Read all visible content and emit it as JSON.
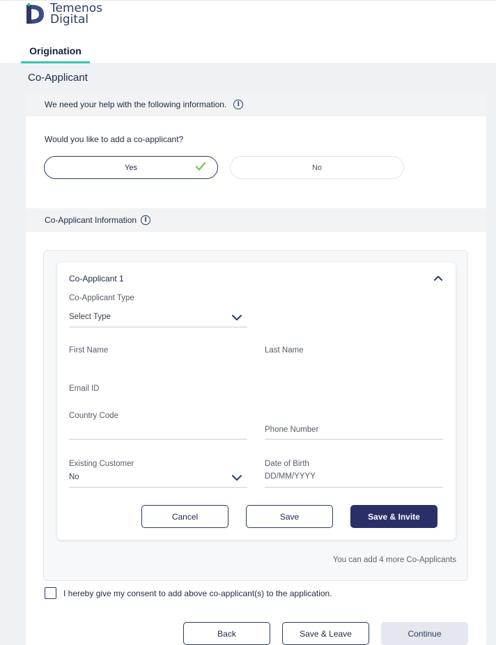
{
  "brand": {
    "line1": "Temenos",
    "line2": "Digital"
  },
  "nav": {
    "tab_label": "Origination"
  },
  "page": {
    "title": "Co-Applicant"
  },
  "help_banner": {
    "text": "We need your help with the following information."
  },
  "question": {
    "text": "Would you like to add a co-applicant?",
    "options": [
      {
        "label": "Yes",
        "selected": true
      },
      {
        "label": "No",
        "selected": false
      }
    ]
  },
  "section": {
    "title": "Co-Applicant Information"
  },
  "coapplicant": {
    "title": "Co-Applicant 1",
    "type": {
      "label": "Co-Applicant Type",
      "value": "Select Type"
    },
    "first_name": {
      "label": "First Name"
    },
    "last_name": {
      "label": "Last Name"
    },
    "email": {
      "label": "Email ID"
    },
    "country_code": {
      "label": "Country Code"
    },
    "phone": {
      "label": "Phone Number"
    },
    "existing_customer": {
      "label": "Existing Customer",
      "value": "No"
    },
    "dob": {
      "label": "Date of Birth",
      "placeholder": "DD/MM/YYYY"
    },
    "buttons": {
      "cancel": "Cancel",
      "save": "Save",
      "save_invite": "Save & Invite"
    }
  },
  "limit_note": "You can add 4 more Co-Applicants",
  "consent": {
    "text": "I hereby give my consent to add above co-applicant(s) to the application.",
    "checked": false
  },
  "footer": {
    "back": "Back",
    "save_leave": "Save & Leave",
    "continue": "Continue"
  },
  "colors": {
    "accent": "#33c7a8",
    "primary": "#2a3067",
    "check": "#7ac143"
  }
}
